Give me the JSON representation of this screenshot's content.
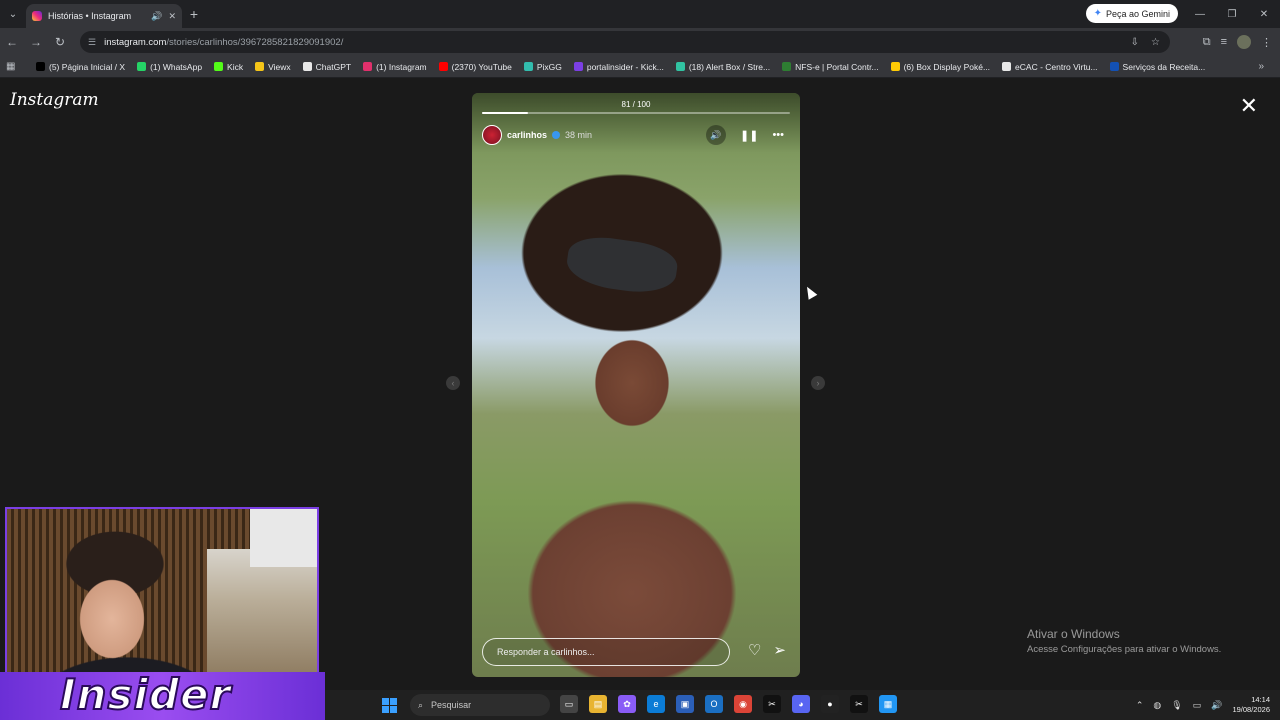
{
  "browser": {
    "tab": {
      "title": "Histórias • Instagram"
    },
    "gemini_label": "Peça ao Gemini",
    "url_host": "instagram.com",
    "url_path": "/stories/carlinhos/3967285821829091902/"
  },
  "bookmarks": [
    {
      "label": "(5) Página Inicial / X",
      "color": "#000000"
    },
    {
      "label": "(1) WhatsApp",
      "color": "#25d366"
    },
    {
      "label": "Kick",
      "color": "#53fc18"
    },
    {
      "label": "Viewx",
      "color": "#f5c518"
    },
    {
      "label": "ChatGPT",
      "color": "#e8e8e8"
    },
    {
      "label": "(1) Instagram",
      "color": "#e1306c"
    },
    {
      "label": "(2370) YouTube",
      "color": "#ff0000"
    },
    {
      "label": "PixGG",
      "color": "#32bcad"
    },
    {
      "label": "portalinsider - Kick...",
      "color": "#7b3fe4"
    },
    {
      "label": "(18) Alert Box / Stre...",
      "color": "#31c3a2"
    },
    {
      "label": "NFS-e | Portal Contr...",
      "color": "#2e7d32"
    },
    {
      "label": "(6) Box Display Poké...",
      "color": "#ffcb05"
    },
    {
      "label": "eCAC - Centro Virtu...",
      "color": "#e8e8e8"
    },
    {
      "label": "Serviços da Receita...",
      "color": "#1351b4"
    }
  ],
  "instagram": {
    "logo": "Instagram",
    "story": {
      "counter": "81 / 100",
      "progress": 0.15,
      "username": "carlinhos",
      "time": "38 min",
      "reply_placeholder": "Responder a carlinhos..."
    }
  },
  "windows_activation": {
    "title": "Ativar o Windows",
    "subtitle": "Acesse Configurações para ativar o Windows."
  },
  "webcam_logo": "Insider",
  "taskbar": {
    "search_placeholder": "Pesquisar",
    "time": "14:14",
    "date": "19/08/2026"
  },
  "icons": {
    "close": "close-icon",
    "heart": "heart-icon",
    "send": "send-icon",
    "pause": "pause-icon",
    "sound": "speaker-icon",
    "more": "more-icon"
  }
}
